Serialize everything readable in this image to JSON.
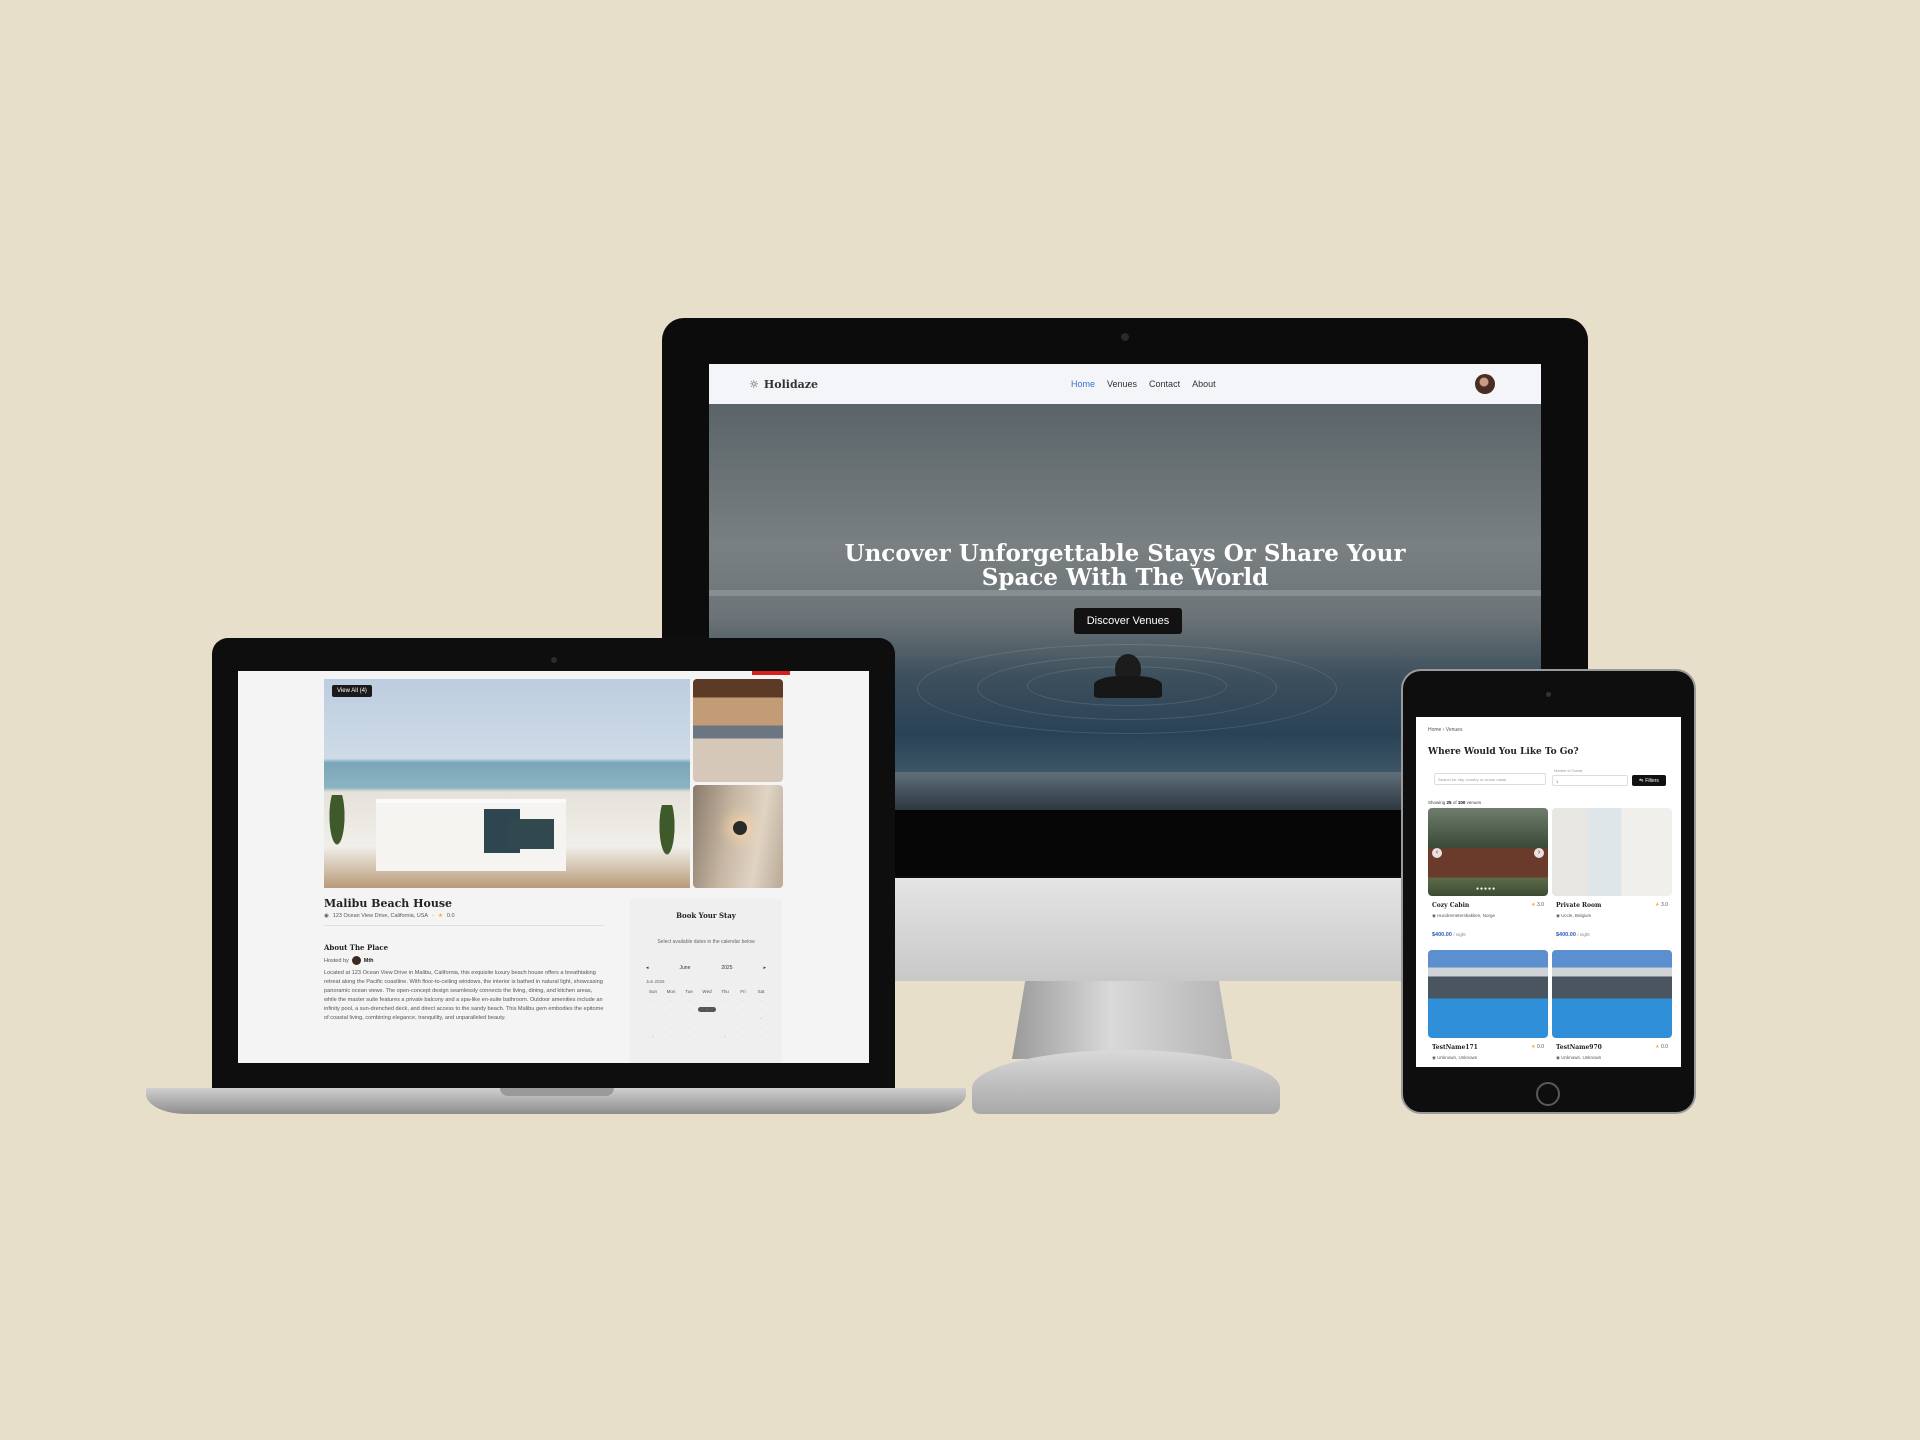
{
  "imac": {
    "brand": "Holidaze",
    "nav": [
      "Home",
      "Venues",
      "Contact",
      "About"
    ],
    "hero_title": "Uncover Unforgettable Stays Or Share Your Space With The World",
    "hero_button": "Discover Venues"
  },
  "laptop": {
    "view_all": "View All (4)",
    "venue_name": "Malibu Beach House",
    "address": "123 Ocean View Drive, California, USA",
    "rating": "0.0",
    "about_heading": "About The Place",
    "hosted_by_label": "Hosted by",
    "host_name": "Mth",
    "about_text": "Located at 123 Ocean View Drive in Malibu, California, this exquisite luxury beach house offers a breathtaking retreat along the Pacific coastline. With floor-to-ceiling windows, the interior is bathed in natural light, showcasing panoramic ocean views. The open-concept design seamlessly connects the living, dining, and kitchen areas, while the master suite features a private balcony and a spa-like en-suite bathroom. Outdoor amenities include an infinity pool, a sun-drenched deck, and direct access to the sandy beach. This Malibu gem embodies the epitome of coastal living, combining elegance, tranquility, and unparalleled beauty.",
    "booking": {
      "title": "Book Your Stay",
      "hint": "Select available dates in the calendar below",
      "month": "June",
      "year": "2025",
      "month_label": "Jun 2025",
      "weekdays": [
        "Sun",
        "Mon",
        "Tue",
        "Wed",
        "Thu",
        "Fri",
        "Sat"
      ]
    }
  },
  "tablet": {
    "breadcrumb": "Home › Venues",
    "heading": "Where Would You Like To Go?",
    "search_placeholder": "Search for city, country or venue name",
    "guests_label": "Number of Guests",
    "guests_value": "1",
    "filters_label": "Filters",
    "showing_prefix": "Showing",
    "showing_count": "25",
    "showing_mid": "of",
    "showing_total": "100",
    "showing_suffix": "venues",
    "venues": [
      {
        "name": "Cozy Cabin",
        "rating": "3.0",
        "location": "Hundremetersbakken, Norge",
        "price": "$400.00",
        "unit": "/ night"
      },
      {
        "name": "Private Room",
        "rating": "3.0",
        "location": "Uccle, Belgium",
        "price": "$400.00",
        "unit": "/ night"
      },
      {
        "name": "TestName171",
        "rating": "0.0",
        "location": "Unknown, Unknown"
      },
      {
        "name": "TestName970",
        "rating": "0.0",
        "location": "Unknown, Unknown"
      }
    ]
  }
}
